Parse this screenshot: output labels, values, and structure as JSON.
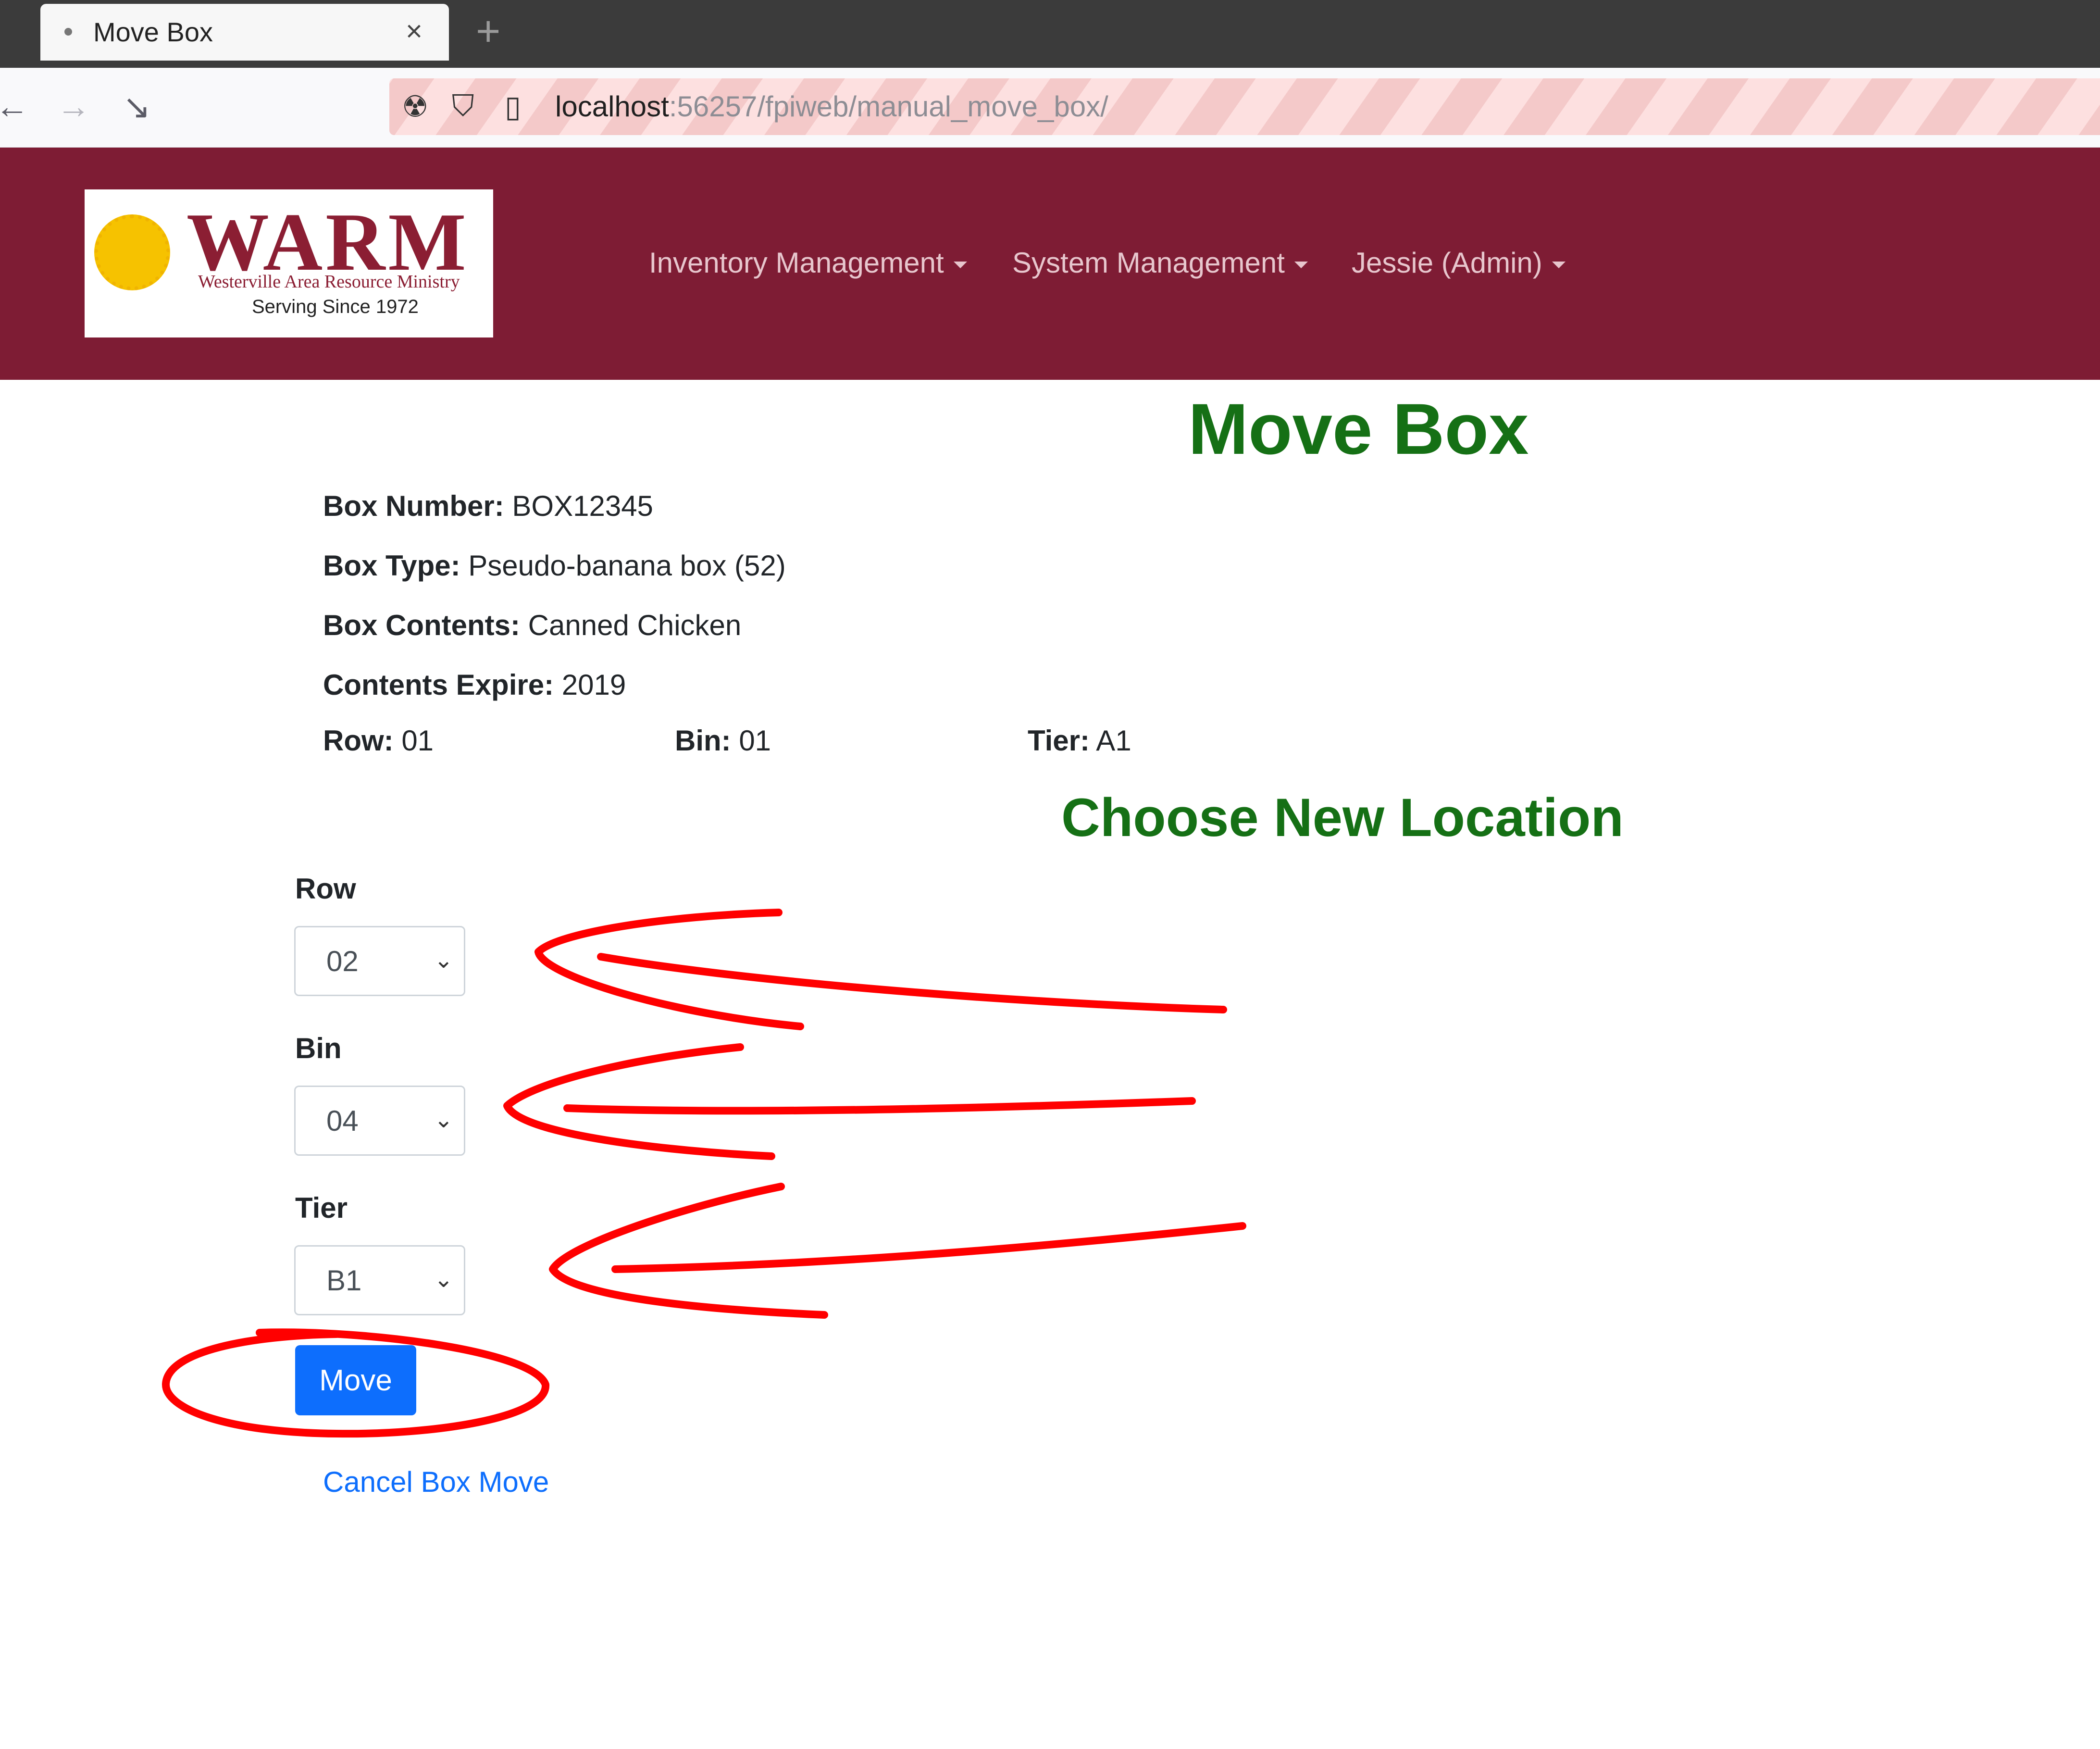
{
  "browser": {
    "tab_title": "Move Box",
    "tab_close": "×",
    "new_tab": "+",
    "url_host": "localhost",
    "url_path": ":56257/fpiweb/manual_move_box/"
  },
  "navbar": {
    "logo": {
      "word": "WARM",
      "line1": "Westerville Area Resource Ministry",
      "line2": "Serving Since 1972"
    },
    "menus": [
      "Inventory Management",
      "System Management",
      "Jessie (Admin)"
    ]
  },
  "page": {
    "title": "Move Box",
    "box_number_label": "Box Number:",
    "box_number": "BOX12345",
    "box_type_label": "Box Type:",
    "box_type": "Pseudo-banana box (52)",
    "box_contents_label": "Box Contents:",
    "box_contents": "Canned Chicken",
    "contents_expire_label": "Contents Expire:",
    "contents_expire": "2019",
    "row_label": "Row:",
    "row": "01",
    "bin_label": "Bin:",
    "bin": "01",
    "tier_label": "Tier:",
    "tier": "A1",
    "subtitle": "Choose New Location",
    "form": {
      "row_label": "Row",
      "row_value": "02",
      "bin_label": "Bin",
      "bin_value": "04",
      "tier_label": "Tier",
      "tier_value": "B1",
      "move_button": "Move",
      "cancel_link": "Cancel Box Move"
    }
  },
  "colors": {
    "navbar": "#7e1c34",
    "heading": "#157015",
    "primary": "#0d6efd",
    "annotation": "#ff0000"
  }
}
